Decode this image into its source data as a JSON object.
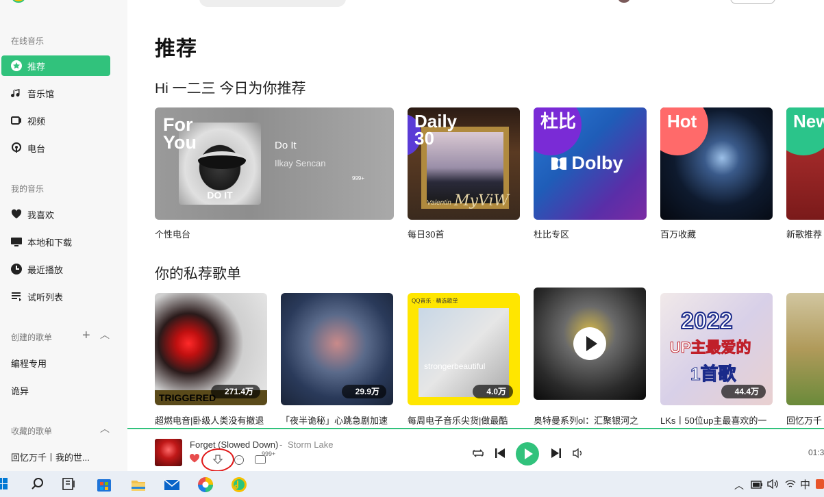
{
  "sidebar": {
    "online_title": "在线音乐",
    "online_items": [
      {
        "label": "推荐",
        "icon": "star-circle-icon",
        "active": true
      },
      {
        "label": "音乐馆",
        "icon": "music-note-icon"
      },
      {
        "label": "视频",
        "icon": "video-icon"
      },
      {
        "label": "电台",
        "icon": "radio-icon"
      }
    ],
    "my_title": "我的音乐",
    "my_items": [
      {
        "label": "我喜欢",
        "icon": "heart-icon"
      },
      {
        "label": "本地和下载",
        "icon": "monitor-icon"
      },
      {
        "label": "最近播放",
        "icon": "clock-icon"
      },
      {
        "label": "试听列表",
        "icon": "list-icon"
      }
    ],
    "created_title": "创建的歌单",
    "created_items": [
      "编程专用",
      "诡异"
    ],
    "collected_title": "收藏的歌单",
    "collected_items": [
      "回忆万千丨我的世..."
    ]
  },
  "main": {
    "page_title": "推荐",
    "greeting": "Hi 一二三 今日为你推荐",
    "for_you": {
      "tag": "For\nYou",
      "cover_text": "DO IT",
      "song": "Do It",
      "artist": "Ilkay Sencan",
      "count": "999+",
      "caption": "个性电台"
    },
    "daily": {
      "tag": "Daily\n30",
      "sig": "MyViW",
      "sig2": "Valentin",
      "caption": "每日30首"
    },
    "dolby": {
      "tag": "杜比",
      "logo": "Dolby",
      "caption": "杜比专区"
    },
    "hot": {
      "tag": "Hot",
      "caption": "百万收藏"
    },
    "new": {
      "tag": "New",
      "caption": "新歌推荐"
    },
    "section2_title": "你的私荐歌单",
    "playlists": [
      {
        "caption": "超燃电音|卧级人类没有撤退",
        "count": "271.4万",
        "strip": "TRIGGERED"
      },
      {
        "caption": "「夜半诡秘」心跳急剧加速",
        "count": "29.9万"
      },
      {
        "caption": "每周电子音乐尖货|做最酷",
        "count": "4.0万",
        "badge": "QQ音乐 · 精选歌单",
        "inner": "strongerbeautiful"
      },
      {
        "caption": "奥特曼系列ol：汇聚银河之",
        "count": ""
      },
      {
        "caption": "LKs丨50位up主最喜欢的一",
        "count": "44.4万",
        "year": "2022",
        "t1": "UP主最爱的",
        "t2": "1首歌"
      },
      {
        "caption": "回忆万千",
        "count": ""
      }
    ]
  },
  "player": {
    "title": "Forget (Slowed Down)",
    "separator": "-",
    "artist": "Storm Lake",
    "comment_count": "999+",
    "time": "01:3"
  },
  "taskbar": {
    "ime": "中"
  },
  "colors": {
    "accent": "#31c27c",
    "annotation": "#e01818"
  }
}
